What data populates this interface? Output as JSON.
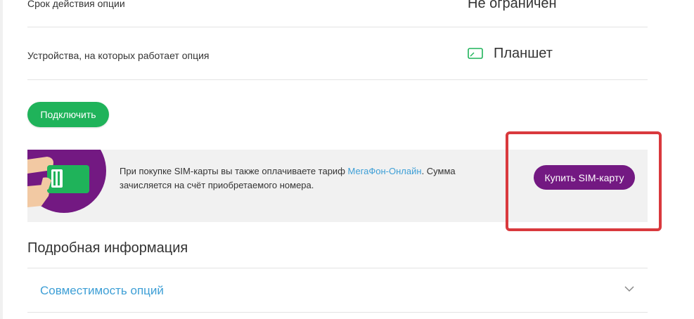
{
  "details": {
    "validity_label": "Срок действия опции",
    "validity_value": "Не ограничен",
    "devices_label": "Устройства, на которых работает опция",
    "devices_icon": "tablet-icon",
    "devices_value": "Планшет"
  },
  "actions": {
    "connect_label": "Подключить"
  },
  "promo": {
    "art_icon": "sim-card-in-hand-icon",
    "text_before": "При покупке SIM-карты вы также оплачиваете тариф ",
    "link_text": "МегаФон-Онлайн",
    "text_after": ". Сумма зачисляется на счёт приобретаемого номера.",
    "buy_label": "Купить SIM-карту",
    "accent_color": "#731982"
  },
  "more_info": {
    "title": "Подробная информация",
    "accordion_label": "Совместимость опций",
    "chevron_icon": "chevron-down-icon"
  },
  "colors": {
    "brand_green": "#1fb35a",
    "brand_purple": "#731982",
    "link_blue": "#3e9fd6",
    "highlight_red": "#d9393d"
  }
}
